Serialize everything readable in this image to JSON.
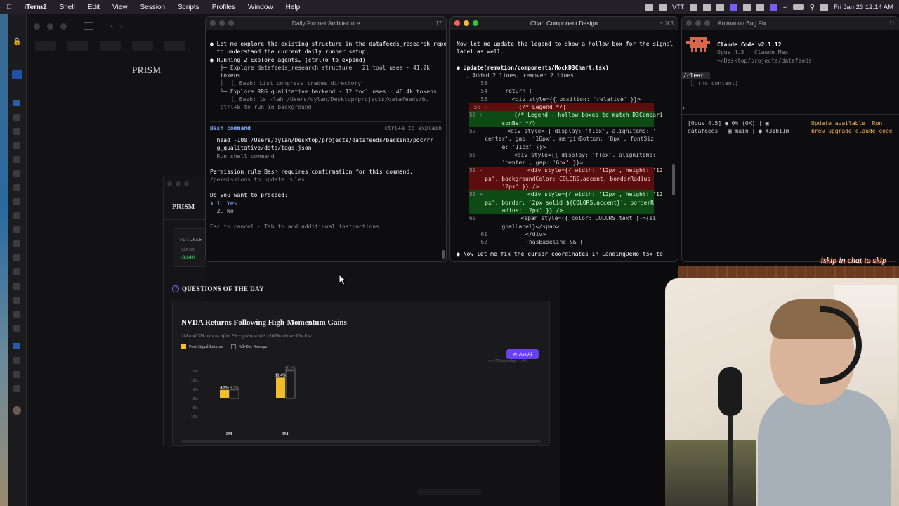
{
  "menubar": {
    "app": "iTerm2",
    "items": [
      "Shell",
      "Edit",
      "View",
      "Session",
      "Scripts",
      "Profiles",
      "Window",
      "Help"
    ],
    "status_text": "VTT",
    "datetime": "Fri Jan 23  12:14 AM"
  },
  "browser": {
    "brand": "PRISM",
    "brand_small": "PRISM",
    "futures_label": "FUTURES",
    "futures_sub": "S&P 500",
    "futures_change": "+0.34%",
    "qotd_title": "QUESTIONS OF THE DAY",
    "card": {
      "title": "NVDA Returns Following High-Momentum Gains",
      "subtitle": "1M and 3M returns after 2%+ gains while >100% above 52w low",
      "legend_post": "Post-Signal Returns",
      "legend_all": "All-Day Average",
      "ask_ai": "Ask AI",
      "note": "n = 79 | avg edge: -1.9%"
    }
  },
  "chart_data": {
    "type": "bar",
    "title": "NVDA Returns Following High-Momentum Gains",
    "categories": [
      "1M",
      "3M"
    ],
    "series": [
      {
        "name": "Post-Signal Returns",
        "values": [
          4.7,
          11.4
        ]
      },
      {
        "name": "All-Day Average",
        "values": [
          4.7,
          15.1
        ]
      }
    ],
    "value_labels": [
      [
        "4.7%",
        "4.7%"
      ],
      [
        "11.4%",
        "15.1%"
      ]
    ],
    "y_ticks": [
      "15%",
      "10%",
      "5%",
      "0%",
      "-5%",
      "-10%"
    ],
    "ylim": [
      -10,
      15
    ],
    "grid": false,
    "legend": "top-left",
    "colors": {
      "post": "#f1bd2b",
      "all": "#6a6a6a"
    }
  },
  "term1": {
    "title": "Daily Runner Architecture",
    "num": "17",
    "lines": [
      "● Let me explore the existing structure in the datafeeds_research repo",
      "  to understand the current daily runner setup.",
      "",
      "● Running 2 Explore agents… (ctrl+o to expand)",
      "   ├─ Explore datafeeds_research structure · 21 tool uses · 41.2k",
      "   tokens",
      "   │  ⎿ Bash: List congress_trades directory",
      "   └─ Explore RRG qualitative backend · 12 tool uses · 46.4k tokens",
      "      ⎿ Bash: ls -lah /Users/dylan/Desktop/projects/datafeeds/b…",
      "   ctrl+b to run in background"
    ],
    "bash_header": "Bash command",
    "bash_hint": "ctrl+e to explain",
    "bash_cmd1": "  head -100 /Users/dylan/Desktop/projects/datafeeds/backend/poc/rr",
    "bash_cmd2": "  g_qualitative/data/tags.json",
    "bash_desc": "  Run shell command",
    "perm1": "Permission rule Bash requires confirmation for this command.",
    "perm2": "/permissions to update rules",
    "question": "Do you want to proceed?",
    "opt_yes": "❯ 1. Yes",
    "opt_no": "  2. No",
    "footer": "Esc to cancel · Tab to add additional instructions"
  },
  "term2": {
    "title": "Chart Component Design",
    "num": "⌥⌘3",
    "intro1": "Now let me update the legend to show a hollow box for the signal",
    "intro2": "label as well.",
    "update_head": "● Update(remotion/components/MockD3Chart.tsx)",
    "update_sub": "  ⎿ Added 2 lines, removed 2 lines",
    "diff": [
      {
        "n": "53",
        "t": "",
        "k": ""
      },
      {
        "n": "54",
        "t": "    return (",
        "k": ""
      },
      {
        "n": "55",
        "t": "      <div style={{ position: 'relative' }}>",
        "k": ""
      },
      {
        "n": "56 -",
        "t": "        {/* Legend */}",
        "k": "del"
      },
      {
        "n": "56 +",
        "t": "        {/* Legend - hollow boxes to match D3Compari",
        "k": "add"
      },
      {
        "n": "",
        "t": "   sonBar */}",
        "k": "add"
      },
      {
        "n": "57",
        "t": "        <div style={{ display: 'flex', alignItems: '",
        "k": ""
      },
      {
        "n": "",
        "t": "   center', gap: '16px', marginBottom: '8px', fontSiz",
        "k": ""
      },
      {
        "n": "",
        "t": "   e: '11px' }}>",
        "k": ""
      },
      {
        "n": "58",
        "t": "          <div style={{ display: 'flex', alignItems:",
        "k": ""
      },
      {
        "n": "",
        "t": "   'center', gap: '6px' }}>",
        "k": ""
      },
      {
        "n": "59 -",
        "t": "            <div style={{ width: '12px', height: '12",
        "k": "del"
      },
      {
        "n": "",
        "t": "   px', backgroundColor: COLORS.accent, borderRadius:",
        "k": "del"
      },
      {
        "n": "",
        "t": "   '2px' }} />",
        "k": "del"
      },
      {
        "n": "59 +",
        "t": "            <div style={{ width: '12px', height: '12",
        "k": "add"
      },
      {
        "n": "",
        "t": "   px', border: `2px solid ${COLORS.accent}`, borderR",
        "k": "add"
      },
      {
        "n": "",
        "t": "   adius: '2px' }} />",
        "k": "add"
      },
      {
        "n": "60",
        "t": "            <span style={{ color: COLORS.text }}>{si",
        "k": ""
      },
      {
        "n": "",
        "t": "   gnalLabel}</span>",
        "k": ""
      },
      {
        "n": "61",
        "t": "          </div>",
        "k": ""
      },
      {
        "n": "62",
        "t": "          {hasBaseline && (",
        "k": ""
      }
    ],
    "outro": "● Now let me fix the cursor coordinates in LandingDemo.tsx to"
  },
  "term3": {
    "title": "Animation Bug Fix",
    "num": "11",
    "app_name": "Claude Code v2.1.12",
    "model": "Opus 4.5 · Claude Max",
    "path": "~/Desktop/projects/datafeeds",
    "cmd": "/clear",
    "cmd_result": "  ⎿ (no content)",
    "prompt": "›",
    "status1": "[Opus 4.5] ● 0% (0K) | ▣",
    "status2": "datafeeds | ▣ main | ● 431h11m",
    "update1": "Update available! Run:",
    "update2": "brew upgrade claude-code"
  },
  "overlay": {
    "skip_text": "!skip in chat to skip"
  }
}
